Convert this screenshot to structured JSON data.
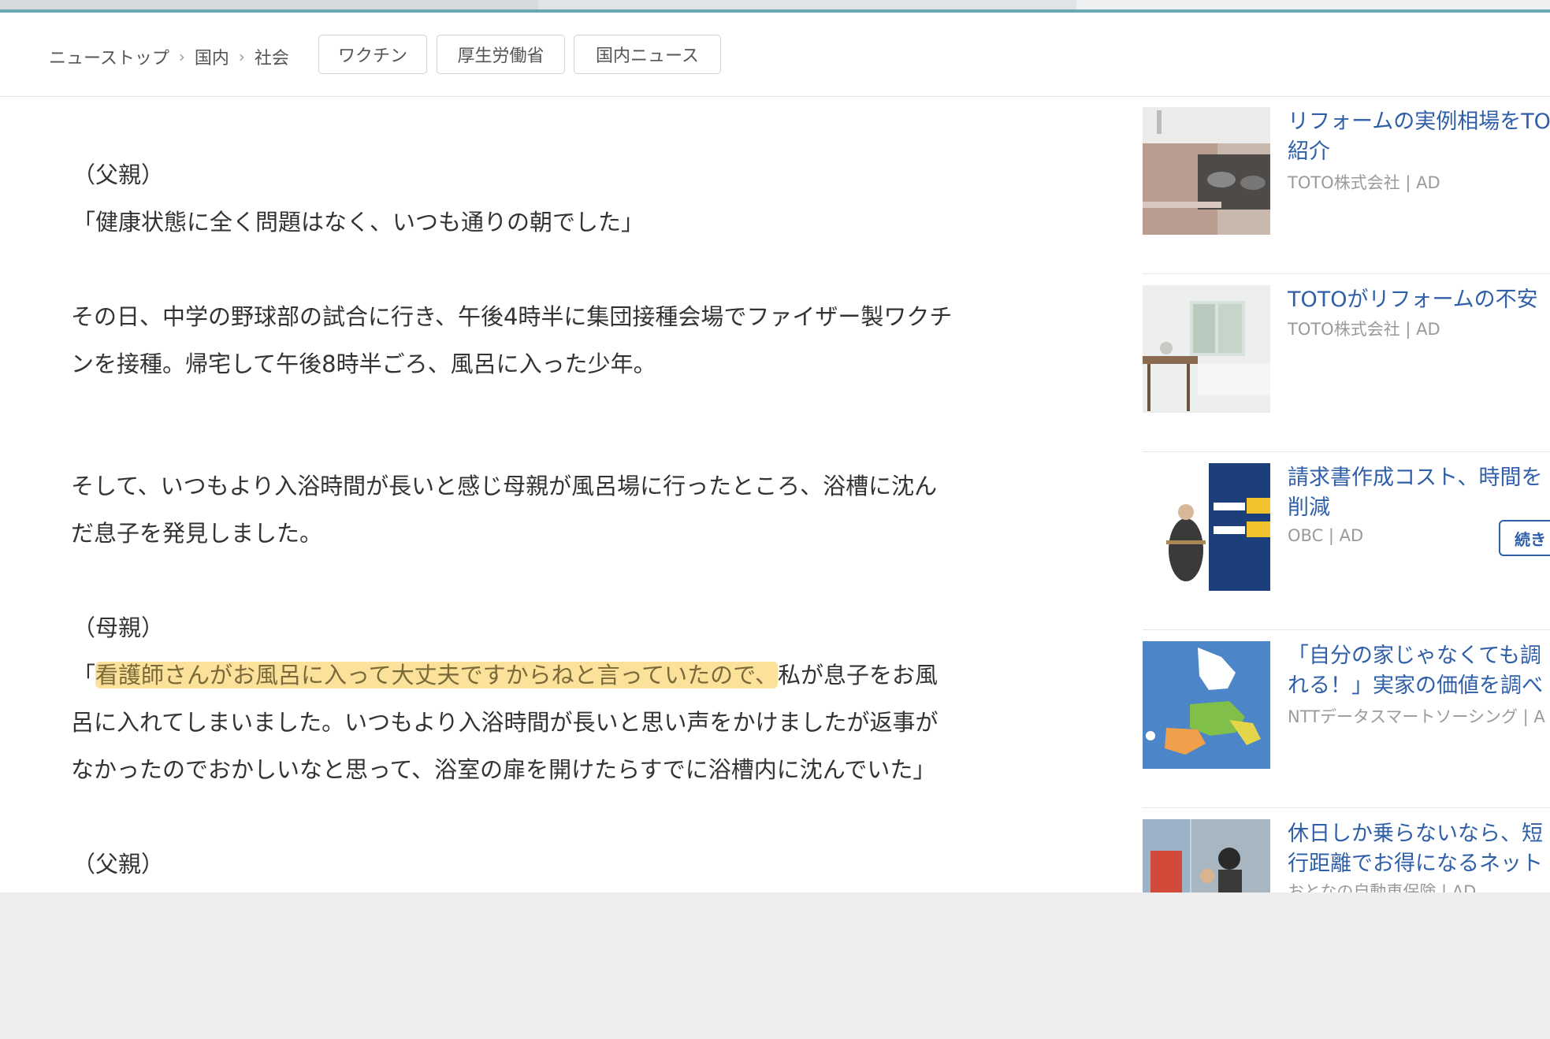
{
  "breadcrumb": {
    "items": [
      "ニューストップ",
      "国内",
      "社会"
    ],
    "separator": "›"
  },
  "tags": [
    "ワクチン",
    "厚生労働省",
    "国内ニュース"
  ],
  "article": {
    "paragraphs": [
      "（父親）",
      "「健康状態に全く問題はなく、いつも通りの朝でした」",
      "その日、中学の野球部の試合に行き、午後4時半に集団接種会場でファイザー製ワクチ",
      "ンを接種。帰宅して午後8時半ごろ、風呂に入った少年。",
      "そして、いつもより入浴時間が長いと感じ母親が風呂場に行ったところ、浴槽に沈ん",
      "だ息子を発見しました。",
      "（母親）",
      "「",
      "看護師さんがお風呂に入って大丈夫ですからねと言っていたので、",
      "私が息子をお風",
      "呂に入れてしまいました。いつもより入浴時間が長いと思い声をかけましたが返事が",
      "なかったのでおかしいなと思って、浴室の扉を開けたらすでに浴槽内に沈んでいた」",
      "（父親）"
    ]
  },
  "ads": [
    {
      "title": "リフォームの実例相場をTO\n紹介",
      "source": "TOTO株式会社 | AD"
    },
    {
      "title": "TOTOがリフォームの不安",
      "source": "TOTO株式会社 | AD"
    },
    {
      "title": "請求書作成コスト、時間を\n削減",
      "source": "OBC | AD",
      "button": "続き"
    },
    {
      "title": "「自分の家じゃなくても調\nれる！」実家の価値を調べ",
      "source": "NTTデータスマートソーシング | A"
    },
    {
      "title": "休日しか乗らないなら、短\n行距離でお得になるネット",
      "source": "おとなの自動車保険 | AD"
    }
  ],
  "colors": {
    "accent": "#6aa7b3",
    "link": "#2f5fa8",
    "highlight": "#fbe19a"
  }
}
